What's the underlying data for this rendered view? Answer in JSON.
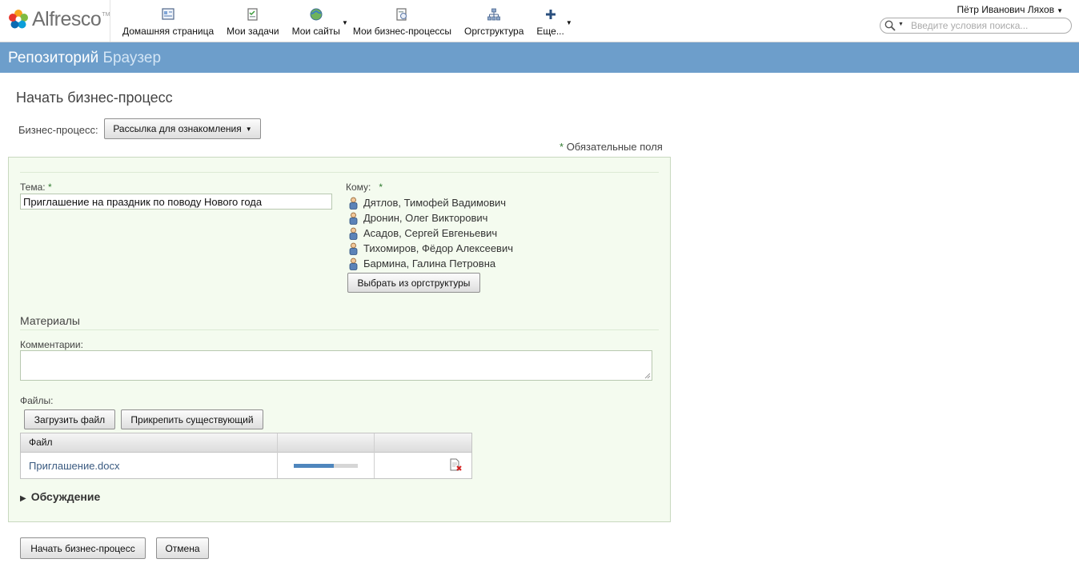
{
  "header": {
    "logo_text": "Alfresco",
    "logo_tm": "TM",
    "nav": [
      {
        "label": "Домашняя страница",
        "icon": "dashboard-icon"
      },
      {
        "label": "Мои задачи",
        "icon": "tasks-icon"
      },
      {
        "label": "Мои сайты",
        "icon": "sites-globe-icon",
        "has_menu": true
      },
      {
        "label": "Мои бизнес-процессы",
        "icon": "workflows-icon"
      },
      {
        "label": "Оргструктура",
        "icon": "org-structure-icon"
      },
      {
        "label": "Еще...",
        "icon": "plus-icon",
        "has_menu": true
      }
    ],
    "user_name": "Пётр Иванович Ляхов",
    "search_placeholder": "Введите условия поиска..."
  },
  "title_bar": {
    "primary": "Репозиторий",
    "secondary": "Браузер",
    "color": "#6d9ecb"
  },
  "page": {
    "heading": "Начать бизнес-процесс",
    "workflow_label": "Бизнес-процесс:",
    "workflow_selected": "Рассылка для ознакомления",
    "required_mark": "*",
    "required_note": "Обязательные поля"
  },
  "form": {
    "subject_label": "Тема:",
    "subject_value": "Приглашение на праздник по поводу Нового года",
    "assignees_label": "Кому:",
    "assignees": [
      "Дятлов, Тимофей Вадимович",
      "Дронин, Олег Викторович",
      "Асадов, Сергей Евгеньевич",
      "Тихомиров, Фёдор Алексеевич",
      "Бармина, Галина Петровна"
    ],
    "pick_button": "Выбрать из оргструктуры",
    "materials_title": "Материалы",
    "comments_label": "Комментарии:",
    "comments_value": "",
    "files_label": "Файлы:",
    "upload_button": "Загрузить файл",
    "attach_button": "Прикрепить существующий",
    "files_table": {
      "headers": [
        "Файл",
        "",
        ""
      ],
      "rows": [
        {
          "file": "Приглашение.docx",
          "progress": 0.62
        }
      ]
    },
    "discussion_label": "Обсуждение"
  },
  "actions": {
    "start_button": "Начать бизнес-процесс",
    "cancel_button": "Отмена"
  }
}
